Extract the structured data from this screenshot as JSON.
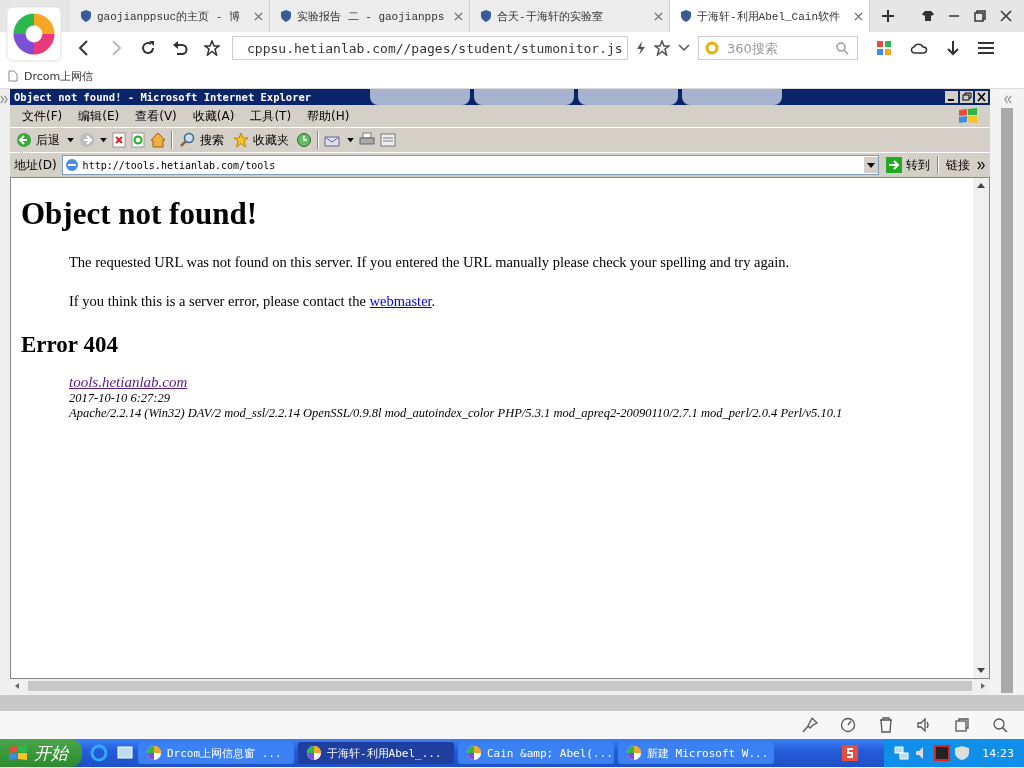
{
  "browser": {
    "tabs": [
      {
        "title": "gaojianppsuc的主页 - 博",
        "selected": false
      },
      {
        "title": "实验报告 二 - gaojianpps",
        "selected": false
      },
      {
        "title": "合天-于海轩的实验室",
        "selected": false
      },
      {
        "title": "于海轩-利用Abel_Cain软件",
        "selected": true
      }
    ],
    "address": "cppsu.hetianlab.com//pages/student/stumonitor.js",
    "search_placeholder": "360搜索",
    "bookmarks": [
      "Drcom上网信"
    ]
  },
  "ie": {
    "title": "Object not found! - Microsoft Internet Explorer",
    "menus": [
      "文件(F)",
      "编辑(E)",
      "查看(V)",
      "收藏(A)",
      "工具(T)",
      "帮助(H)"
    ],
    "back_label": "后退",
    "search_label": "搜索",
    "favorites_label": "收藏夹",
    "address_label": "地址(D)",
    "url": "http://tools.hetianlab.com/tools",
    "go_label": "转到",
    "links_label": "链接"
  },
  "page": {
    "heading": "Object not found!",
    "paragraph": "The requested URL was not found on this server. If you entered the URL manually please check your spelling and try again.",
    "contact": {
      "before": "If you think this is a server error, please contact the ",
      "link": "webmaster",
      "after": "."
    },
    "error_heading": "Error 404",
    "host_link": "tools.hetianlab.com",
    "date": "2017-10-10 6:27:29",
    "server": "Apache/2.2.14 (Win32) DAV/2 mod_ssl/2.2.14 OpenSSL/0.9.8l mod_autoindex_color PHP/5.3.1 mod_apreq2-20090110/2.7.1 mod_perl/2.0.4 Perl/v5.10.1"
  },
  "taskbar": {
    "start": "开始",
    "items": [
      {
        "label": "Drcom上网信息窗 ...",
        "selected": false
      },
      {
        "label": "于海轩-利用Abel_...",
        "selected": true
      },
      {
        "label": "Cain &amp; Abel(...",
        "selected": false
      },
      {
        "label": "新建 Microsoft W...",
        "selected": false
      }
    ],
    "clock": "14:23"
  }
}
